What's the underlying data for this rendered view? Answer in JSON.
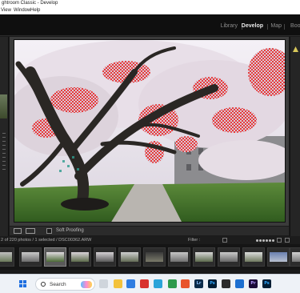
{
  "window": {
    "title": "ghtroom Classic - Develop"
  },
  "menu": [
    "View",
    "Window",
    "Help"
  ],
  "modules": {
    "library": "Library",
    "develop": "Develop",
    "map": "Map",
    "book": "Book"
  },
  "toolbar": {
    "soft_proofing": "Soft Proofing"
  },
  "filmstrip_info": {
    "status": "2 of 220 photos / 1 selected / DSC00362.ARW",
    "filter_label": "Filter :"
  },
  "filmstrip": {
    "thumb_count": 13,
    "selected_index": 2
  },
  "taskbar": {
    "search_placeholder": "Search",
    "app_icons": [
      "file-explorer-icon",
      "mail-icon",
      "edge-icon",
      "store-icon",
      "chrome-icon",
      "lightroom-classic-icon",
      "photoshop-icon",
      "terminal-icon",
      "settings-icon",
      "premiere-icon",
      "photoshop-2-icon"
    ]
  },
  "colors": {
    "clipping_highlight": "#e83a3a",
    "accent": "#1f6fe0"
  }
}
